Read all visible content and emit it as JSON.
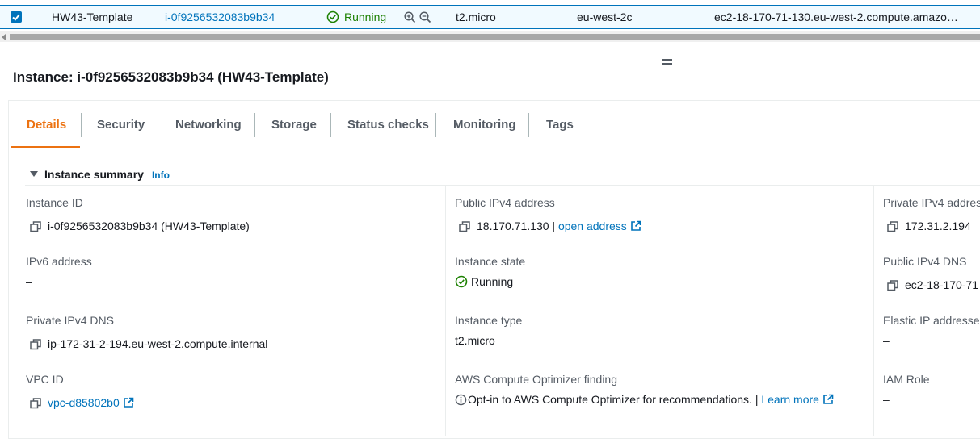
{
  "row": {
    "name": "HW43-Template",
    "instance_id": "i-0f9256532083b9b34",
    "state": "Running",
    "type": "t2.micro",
    "az": "eu-west-2c",
    "public_dns": "ec2-18-170-71-130.eu-west-2.compute.amazo…"
  },
  "instance_title": "Instance: i-0f9256532083b9b34 (HW43-Template)",
  "tabs": [
    "Details",
    "Security",
    "Networking",
    "Storage",
    "Status checks",
    "Monitoring",
    "Tags"
  ],
  "active_tab": "Details",
  "summary": {
    "header": "Instance summary",
    "info": "Info",
    "instance_id_label": "Instance ID",
    "instance_id_value": "i-0f9256532083b9b34 (HW43-Template)",
    "ipv6_label": "IPv6 address",
    "ipv6_value": "–",
    "private_dns_label": "Private IPv4 DNS",
    "private_dns_value": "ip-172-31-2-194.eu-west-2.compute.internal",
    "vpc_label": "VPC ID",
    "vpc_value": "vpc-d85802b0",
    "public_ipv4_label": "Public IPv4 address",
    "public_ipv4_value": "18.170.71.130 |",
    "open_address": "open address",
    "state_label": "Instance state",
    "state_value": "Running",
    "type_label": "Instance type",
    "type_value": "t2.micro",
    "optimizer_label": "AWS Compute Optimizer finding",
    "optimizer_value": "Opt-in to AWS Compute Optimizer for recommendations. |",
    "learn_more": "Learn more",
    "private_ipv4_label": "Private IPv4 addres",
    "private_ipv4_value": "172.31.2.194",
    "public_dns_label": "Public IPv4 DNS",
    "public_dns_value": "ec2-18-170-71",
    "elastic_label": "Elastic IP addresses",
    "elastic_value": "–",
    "iam_label": "IAM Role",
    "iam_value": "–"
  },
  "colors": {
    "link": "#0073bb",
    "ok": "#1d8102",
    "active_tab": "#ec7211",
    "row_bg": "#f1faff"
  }
}
